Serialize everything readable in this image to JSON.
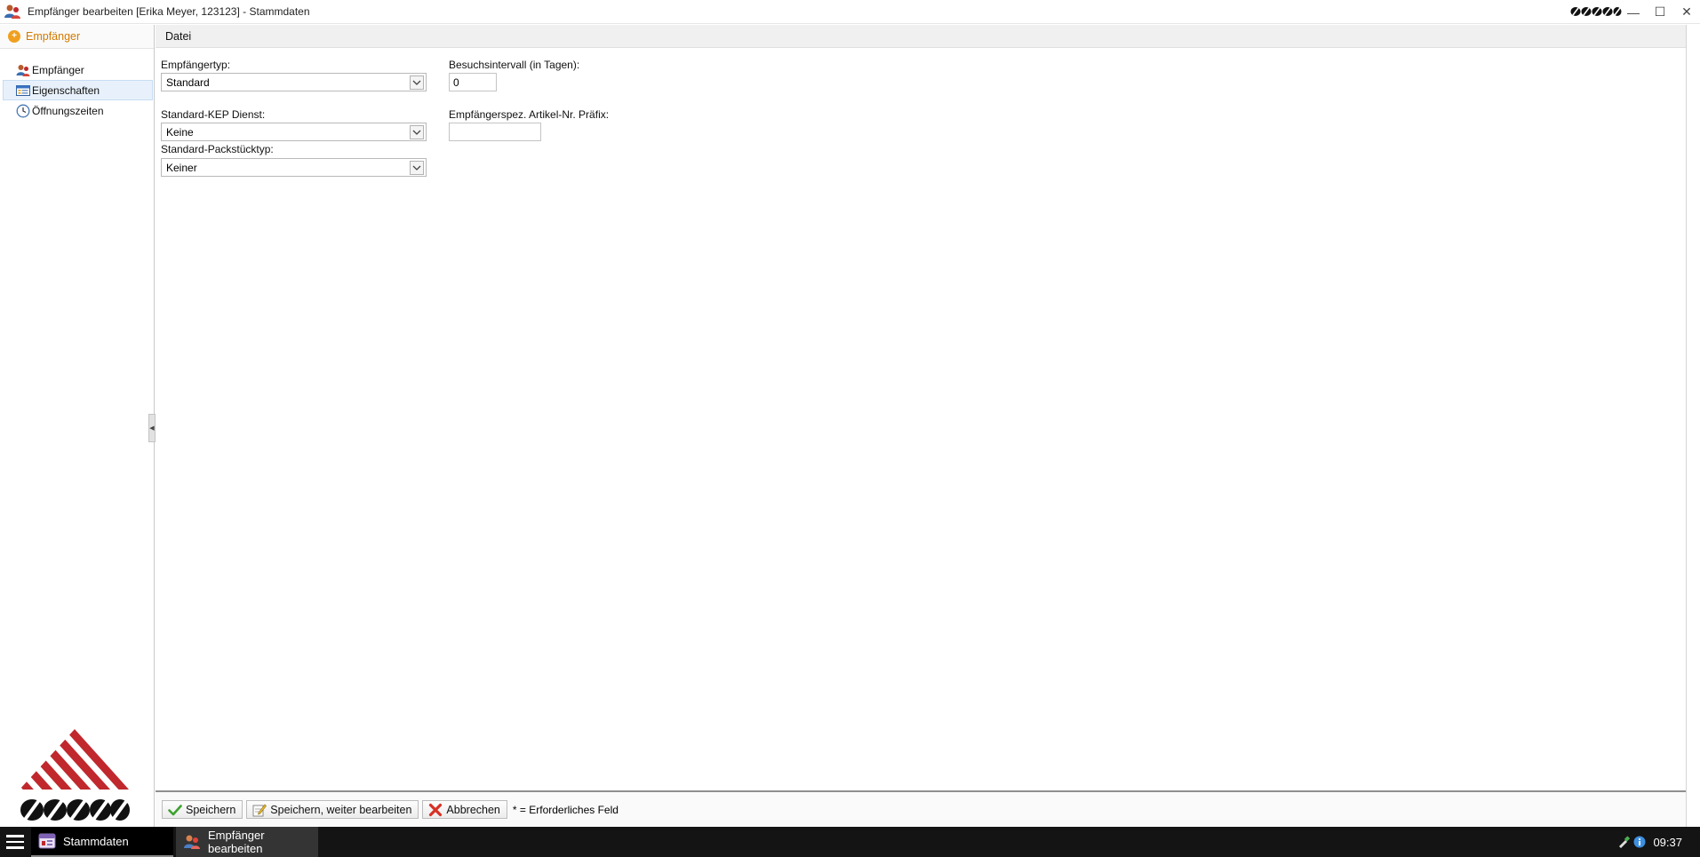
{
  "window": {
    "title": "Empfänger bearbeiten [Erika Meyer, 123123] - Stammdaten",
    "controls": {
      "minimize": "—",
      "maximize": "☐",
      "close": "✕"
    }
  },
  "sidebar": {
    "header": "Empfänger",
    "items": [
      {
        "label": "Empfänger",
        "icon": "users-icon",
        "selected": false
      },
      {
        "label": "Eigenschaften",
        "icon": "properties-icon",
        "selected": true
      },
      {
        "label": "Öffnungszeiten",
        "icon": "clock-icon",
        "selected": false
      }
    ]
  },
  "menubar": {
    "file": "Datei"
  },
  "form": {
    "recipient_type": {
      "label": "Empfängertyp:",
      "value": "Standard"
    },
    "kep_service": {
      "label": "Standard-KEP Dienst:",
      "value": "Keine"
    },
    "package_type": {
      "label": "Standard-Packstücktyp:",
      "value": "Keiner"
    },
    "visit_interval": {
      "label": "Besuchsintervall (in Tagen):",
      "value": "0"
    },
    "article_prefix": {
      "label": "Empfängerspez. Artikel-Nr. Präfix:",
      "value": ""
    }
  },
  "footer": {
    "save": "Speichern",
    "save_continue": "Speichern, weiter bearbeiten",
    "cancel": "Abbrechen",
    "required_note": "* = Erforderliches Feld"
  },
  "taskbar": {
    "tasks": [
      {
        "label": "Stammdaten",
        "active": true
      },
      {
        "label": "Empfänger bearbeiten",
        "active": false
      }
    ],
    "clock": "09:37"
  },
  "colors": {
    "accent_orange": "#d27a00",
    "brand_red": "#c0282d",
    "taskbar": "#141414"
  }
}
